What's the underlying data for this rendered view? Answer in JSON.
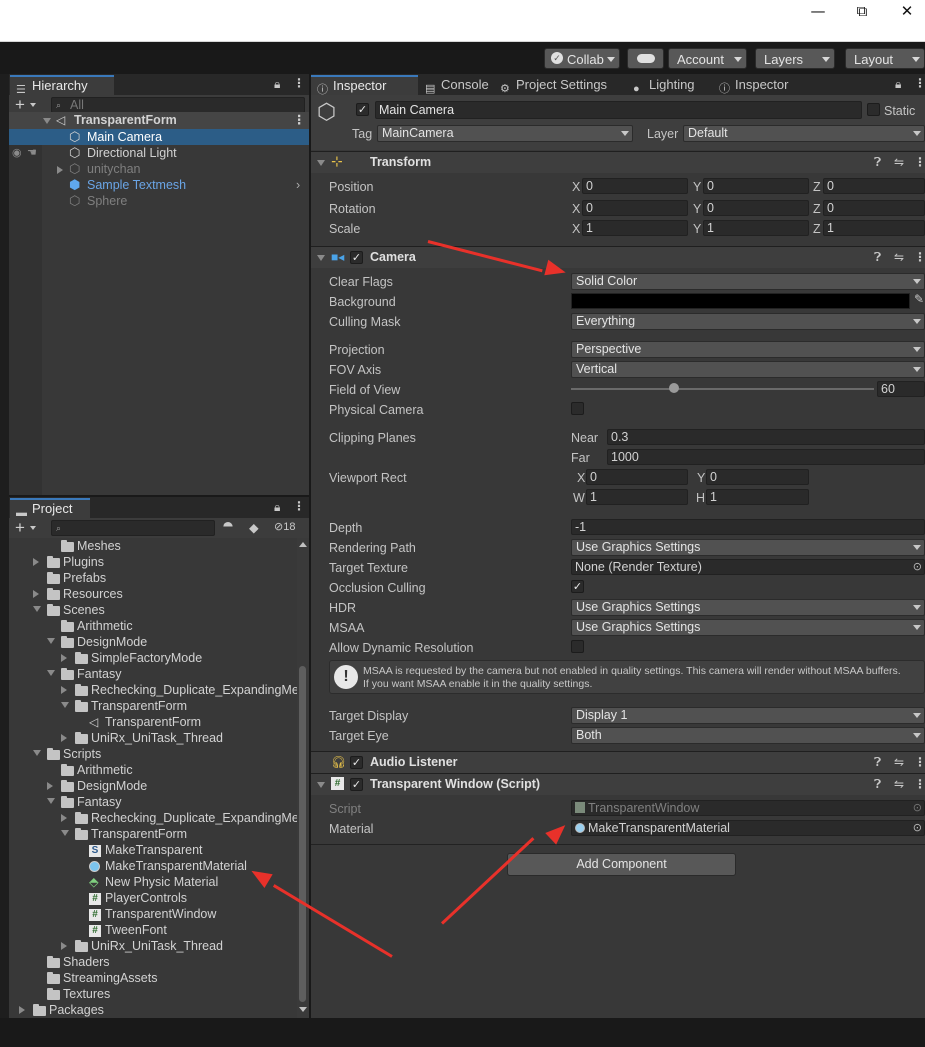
{
  "window": {
    "minimize": "—",
    "maximize": "⧉",
    "close": "✕"
  },
  "toolbar": {
    "collab": "Collab",
    "account": "Account",
    "layers": "Layers",
    "layout": "Layout"
  },
  "hierarchy": {
    "tab": "Hierarchy",
    "search_placeholder": "All",
    "scene": "TransparentForm",
    "items": [
      "Main Camera",
      "Directional Light",
      "unitychan",
      "Sample Textmesh",
      "Sphere"
    ]
  },
  "project": {
    "tab": "Project",
    "hidden_count": "18",
    "tree": [
      {
        "label": "Meshes"
      },
      {
        "label": "Plugins"
      },
      {
        "label": "Prefabs"
      },
      {
        "label": "Resources"
      },
      {
        "label": "Scenes"
      },
      {
        "label": "Arithmetic"
      },
      {
        "label": "DesignMode"
      },
      {
        "label": "SimpleFactoryMode"
      },
      {
        "label": "Fantasy"
      },
      {
        "label": "Rechecking_Duplicate_ExpandingMet"
      },
      {
        "label": "TransparentForm"
      },
      {
        "label": "TransparentForm"
      },
      {
        "label": "UniRx_UniTask_Thread"
      },
      {
        "label": "Scripts"
      },
      {
        "label": "Arithmetic"
      },
      {
        "label": "DesignMode"
      },
      {
        "label": "Fantasy"
      },
      {
        "label": "Rechecking_Duplicate_ExpandingMet"
      },
      {
        "label": "TransparentForm"
      },
      {
        "label": "MakeTransparent"
      },
      {
        "label": "MakeTransparentMaterial"
      },
      {
        "label": "New Physic Material"
      },
      {
        "label": "PlayerControls"
      },
      {
        "label": "TransparentWindow"
      },
      {
        "label": "TweenFont"
      },
      {
        "label": "UniRx_UniTask_Thread"
      },
      {
        "label": "Shaders"
      },
      {
        "label": "StreamingAssets"
      },
      {
        "label": "Textures"
      },
      {
        "label": "Packages"
      }
    ]
  },
  "inspector": {
    "tabs": [
      "Inspector",
      "Console",
      "Project Settings",
      "Lighting",
      "Inspector"
    ],
    "object_name": "Main Camera",
    "static_label": "Static",
    "tag_label": "Tag",
    "tag_value": "MainCamera",
    "layer_label": "Layer",
    "layer_value": "Default",
    "transform": {
      "title": "Transform",
      "position_label": "Position",
      "position": [
        "0",
        "0",
        "0"
      ],
      "rotation_label": "Rotation",
      "rotation": [
        "0",
        "0",
        "0"
      ],
      "scale_label": "Scale",
      "scale": [
        "1",
        "1",
        "1"
      ]
    },
    "camera": {
      "title": "Camera",
      "clear_flags_label": "Clear Flags",
      "clear_flags": "Solid Color",
      "background_label": "Background",
      "culling_mask_label": "Culling Mask",
      "culling_mask": "Everything",
      "projection_label": "Projection",
      "projection": "Perspective",
      "fov_axis_label": "FOV Axis",
      "fov_axis": "Vertical",
      "fov_label": "Field of View",
      "fov": "60",
      "physical_camera_label": "Physical Camera",
      "clipping_planes_label": "Clipping Planes",
      "near_label": "Near",
      "near": "0.3",
      "far_label": "Far",
      "far": "1000",
      "viewport_rect_label": "Viewport Rect",
      "vx": "0",
      "vy": "0",
      "vw": "1",
      "vh": "1",
      "depth_label": "Depth",
      "depth": "-1",
      "rendering_path_label": "Rendering Path",
      "rendering_path": "Use Graphics Settings",
      "target_texture_label": "Target Texture",
      "target_texture": "None (Render Texture)",
      "occlusion_culling_label": "Occlusion Culling",
      "hdr_label": "HDR",
      "hdr": "Use Graphics Settings",
      "msaa_label": "MSAA",
      "msaa": "Use Graphics Settings",
      "dynamic_resolution_label": "Allow Dynamic Resolution",
      "warning_line1": "MSAA is requested by the camera but not enabled in quality settings. This camera will render without MSAA buffers.",
      "warning_line2": "If you want MSAA enable it in the quality settings.",
      "target_display_label": "Target Display",
      "target_display": "Display 1",
      "target_eye_label": "Target Eye",
      "target_eye": "Both"
    },
    "audio_listener": {
      "title": "Audio Listener"
    },
    "transparent_window": {
      "title": "Transparent Window (Script)",
      "script_label": "Script",
      "script": "TransparentWindow",
      "material_label": "Material",
      "material": "MakeTransparentMaterial"
    },
    "add_component": "Add Component"
  },
  "annotation_color": "#e8312a"
}
